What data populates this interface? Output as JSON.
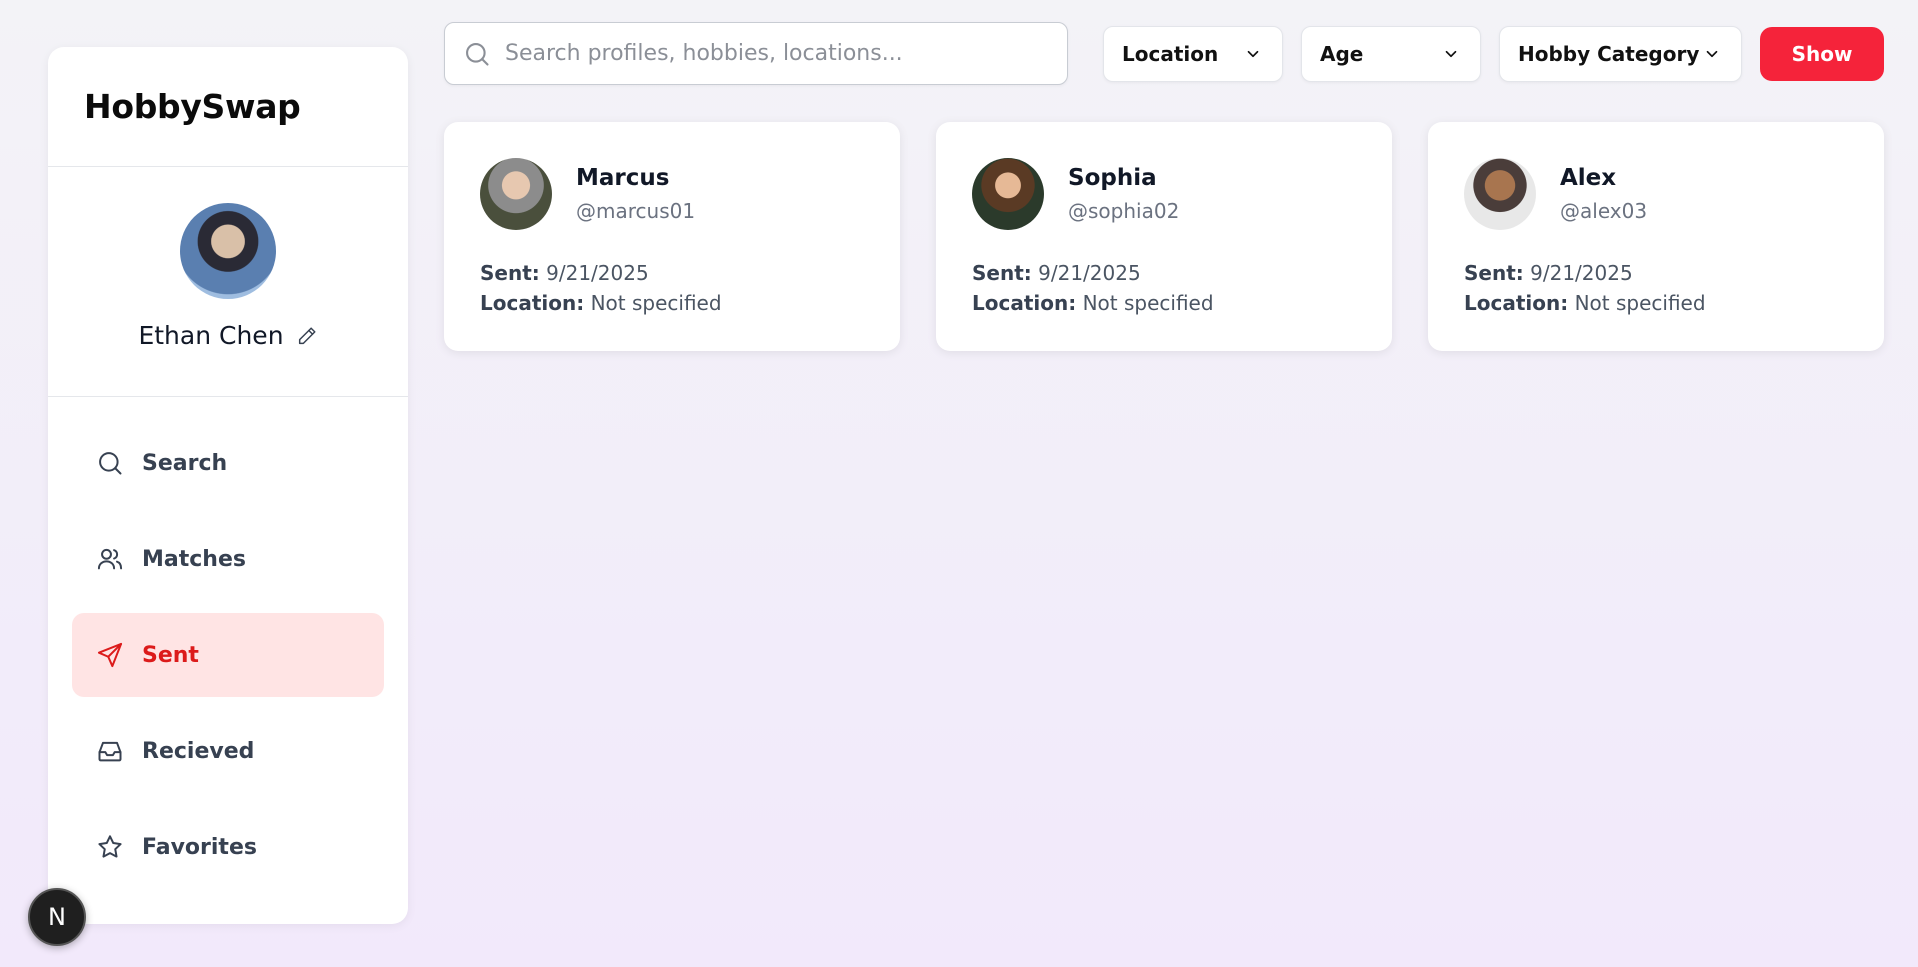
{
  "app": {
    "brand": "HobbySwap"
  },
  "profile": {
    "name": "Ethan Chen"
  },
  "nav": {
    "items": [
      {
        "label": "Search",
        "icon": "search-icon"
      },
      {
        "label": "Matches",
        "icon": "users-icon"
      },
      {
        "label": "Sent",
        "icon": "send-icon",
        "active": true
      },
      {
        "label": "Recieved",
        "icon": "inbox-icon"
      },
      {
        "label": "Favorites",
        "icon": "star-icon"
      }
    ]
  },
  "search": {
    "placeholder": "Search profiles, hobbies, locations..."
  },
  "filters": {
    "location": "Location",
    "age": "Age",
    "hobby": "Hobby Category",
    "show": "Show"
  },
  "labels": {
    "sent": "Sent:",
    "location": "Location:"
  },
  "cards": [
    {
      "name": "Marcus",
      "handle": "@marcus01",
      "sent": "9/21/2025",
      "location": "Not specified"
    },
    {
      "name": "Sophia",
      "handle": "@sophia02",
      "sent": "9/21/2025",
      "location": "Not specified"
    },
    {
      "name": "Alex",
      "handle": "@alex03",
      "sent": "9/21/2025",
      "location": "Not specified"
    }
  ],
  "badge": {
    "letter": "N"
  },
  "colors": {
    "accent": "#f5233a",
    "active_bg": "#ffe4e4",
    "active_text": "#dc1b1b"
  }
}
